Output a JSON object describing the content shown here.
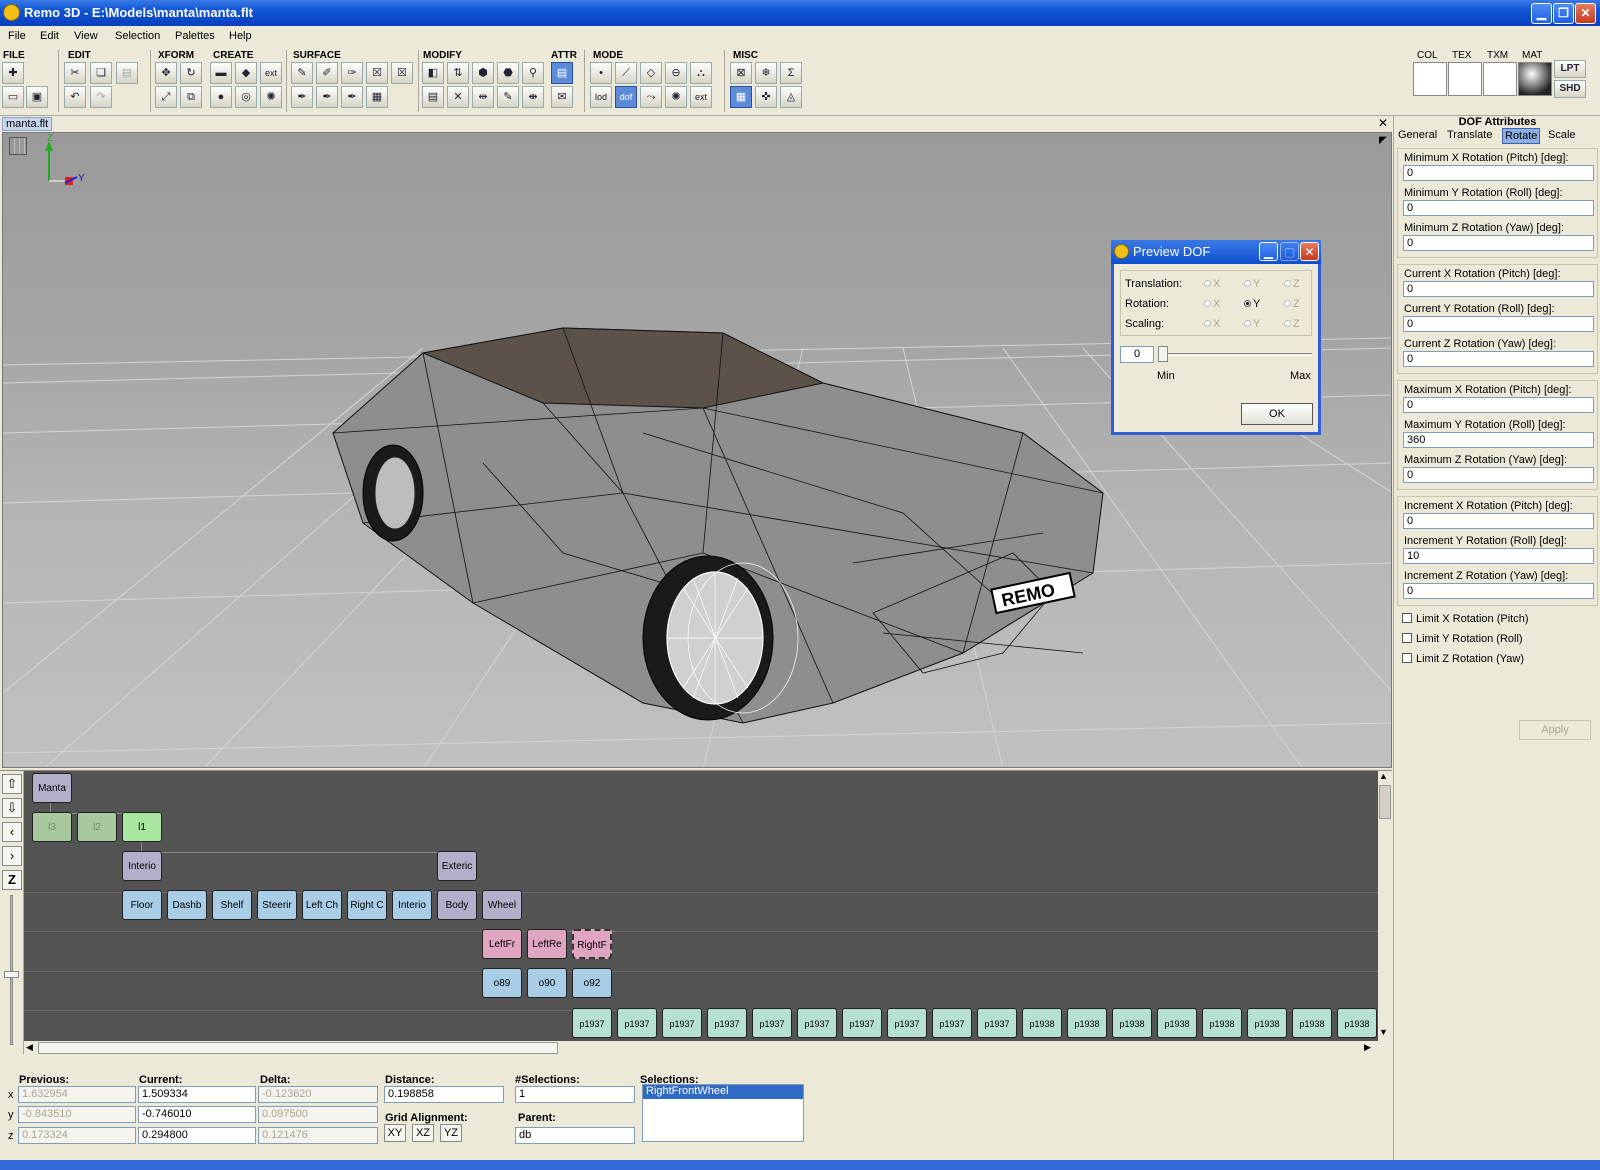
{
  "window": {
    "title": "Remo 3D - E:\\Models\\manta\\manta.flt"
  },
  "menu": [
    "File",
    "Edit",
    "View",
    "Selection",
    "Palettes",
    "Help"
  ],
  "toolbar": {
    "groups": [
      "FILE",
      "EDIT",
      "XFORM",
      "CREATE",
      "SURFACE",
      "MODIFY",
      "ATTR",
      "MODE",
      "MISC"
    ],
    "mode_lod": "lod",
    "mode_dof": "dof",
    "ext": "ext",
    "palette": {
      "col": "COL",
      "tex": "TEX",
      "txm": "TXM",
      "mat": "MAT",
      "lpt": "LPT",
      "shd": "SHD"
    }
  },
  "document_tab": "manta.flt",
  "viewport": {
    "axis_z": "Z",
    "axis_y": "Y",
    "plate": "REMO"
  },
  "attributes": {
    "title": "DOF Attributes",
    "tabs": [
      "General",
      "Translate",
      "Rotate",
      "Scale"
    ],
    "active_tab": "Rotate",
    "fields": [
      {
        "label": "Minimum X Rotation (Pitch) [deg]:",
        "value": "0"
      },
      {
        "label": "Minimum Y Rotation (Roll) [deg]:",
        "value": "0"
      },
      {
        "label": "Minimum Z Rotation (Yaw) [deg]:",
        "value": "0"
      },
      {
        "label": "Current X Rotation (Pitch) [deg]:",
        "value": "0"
      },
      {
        "label": "Current Y Rotation (Roll) [deg]:",
        "value": "0"
      },
      {
        "label": "Current Z Rotation (Yaw) [deg]:",
        "value": "0"
      },
      {
        "label": "Maximum X Rotation (Pitch) [deg]:",
        "value": "0"
      },
      {
        "label": "Maximum Y Rotation (Roll) [deg]:",
        "value": "360"
      },
      {
        "label": "Maximum Z Rotation (Yaw) [deg]:",
        "value": "0"
      },
      {
        "label": "Increment X Rotation (Pitch) [deg]:",
        "value": "0"
      },
      {
        "label": "Increment Y Rotation (Roll) [deg]:",
        "value": "10"
      },
      {
        "label": "Increment Z Rotation (Yaw) [deg]:",
        "value": "0"
      }
    ],
    "checks": [
      "Limit X Rotation (Pitch)",
      "Limit Y Rotation (Roll)",
      "Limit Z Rotation (Yaw)"
    ],
    "apply": "Apply"
  },
  "preview_dof": {
    "title": "Preview DOF",
    "rows": [
      "Translation:",
      "Rotation:",
      "Scaling:"
    ],
    "axes": [
      "X",
      "Y",
      "Z"
    ],
    "selected": "Rotation:Y",
    "slider_value": "0",
    "slider_position": 0,
    "min": "Min",
    "max": "Max",
    "ok": "OK"
  },
  "scene_graph": {
    "root": "Manta",
    "lods": [
      "l3",
      "l2",
      "l1"
    ],
    "groups": [
      "Interio",
      "Exteric"
    ],
    "objects": [
      "Floor",
      "Dashb",
      "Shelf",
      "Steerir",
      "Left Ch",
      "Right C",
      "Interio",
      "Body",
      "Wheel"
    ],
    "dofs": [
      "LeftFr",
      "LeftRe",
      "RightF"
    ],
    "objects2": [
      "o89",
      "o90",
      "o92"
    ],
    "polys": [
      "p1937",
      "p1937",
      "p1937",
      "p1937",
      "p1937",
      "p1937",
      "p1937",
      "p1937",
      "p1937",
      "p1937",
      "p1938",
      "p1938",
      "p1938",
      "p1938",
      "p1938",
      "p1938",
      "p1938",
      "p1938"
    ]
  },
  "status": {
    "previous_label": "Previous:",
    "current_label": "Current:",
    "delta_label": "Delta:",
    "distance_label": "Distance:",
    "selections_count_label": "#Selections:",
    "selections_label": "Selections:",
    "grid_label": "Grid Alignment:",
    "parent_label": "Parent:",
    "x": "x",
    "y": "y",
    "z": "z",
    "previous": [
      "1.632954",
      "-0.843510",
      "0.173324"
    ],
    "current": [
      "1.509334",
      "-0.746010",
      "0.294800"
    ],
    "delta": [
      "-0.123620",
      "0.097500",
      "0.121476"
    ],
    "distance": "0.198858",
    "selections_count": "1",
    "grid": [
      "XY",
      "XZ",
      "YZ"
    ],
    "parent": "db",
    "selection_item": "RightFrontWheel"
  }
}
